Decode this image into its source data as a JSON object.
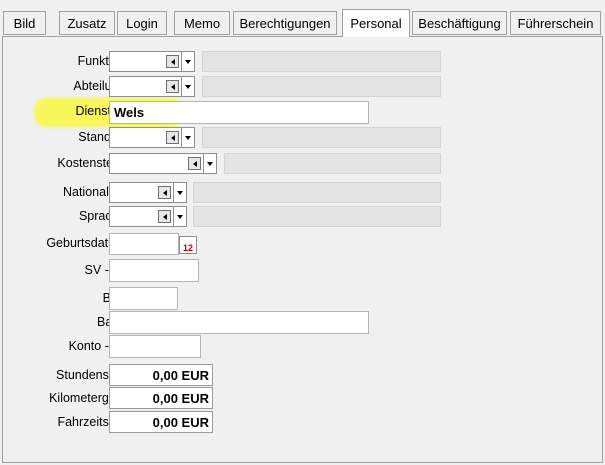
{
  "tabs": [
    {
      "label": "Bild",
      "active": false
    },
    {
      "label": "Zusatz",
      "active": false
    },
    {
      "label": "Login",
      "active": false
    },
    {
      "label": "Memo",
      "active": false
    },
    {
      "label": "Berechtigungen",
      "active": false
    },
    {
      "label": "Personal",
      "active": true
    },
    {
      "label": "Beschäftigung",
      "active": false
    },
    {
      "label": "Führerschein",
      "active": false
    }
  ],
  "fields": {
    "funktion": {
      "label": "Funktion:",
      "value": ""
    },
    "abteilung": {
      "label": "Abteilung:",
      "value": ""
    },
    "dienstort": {
      "label": "Dienstort:",
      "value": "Wels"
    },
    "standort": {
      "label": "Standort:",
      "value": ""
    },
    "kostenstelle": {
      "label": "Kostenstelle:",
      "value": ""
    },
    "nationalitaet": {
      "label": "Nationalität:",
      "value": ""
    },
    "sprache": {
      "label": "Sprache:",
      "value": ""
    },
    "geburtsdatum": {
      "label": "Geburtsdatum:",
      "value": ""
    },
    "sv_nr": {
      "label": "SV - Nr:",
      "value": ""
    },
    "blz": {
      "label": "BLZ:",
      "value": ""
    },
    "bank": {
      "label": "Bank:",
      "value": ""
    },
    "konto_nr": {
      "label": "Konto - Nr:",
      "value": ""
    },
    "stundensatz": {
      "label": "Stundensatz:",
      "value": "0,00 EUR"
    },
    "kilometergeld": {
      "label": "Kilometergeld:",
      "value": "0,00 EUR"
    },
    "fahrzeitsatz": {
      "label": "Fahrzeitsatz:",
      "value": "0,00 EUR"
    }
  },
  "calendar_icon_text": "12",
  "colors": {
    "highlight": "#f7f75a",
    "accent": "#b00000"
  }
}
